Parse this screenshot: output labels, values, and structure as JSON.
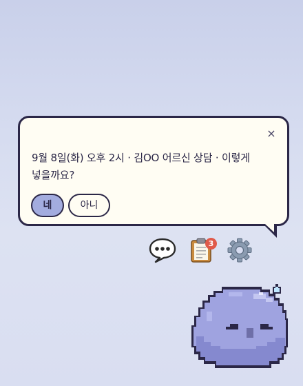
{
  "bubble": {
    "close_symbol": "×",
    "message_line1": "9월 8일(화) 오후 2시 · 김OO 어르신 상담 · 이렇게",
    "message_line2": "넣을까요?",
    "yes_label": "네",
    "no_label": "아니"
  },
  "actions": {
    "chat_icon": "speech-balloon-icon",
    "tasks_icon": "clipboard-icon",
    "tasks_badge": "3",
    "settings_icon": "gear-icon"
  },
  "mascot": {
    "name": "blob-mascot",
    "expression": "sleepy",
    "sweat_drop": true
  },
  "colors": {
    "accent": "#a3acdf",
    "outline": "#2b2747",
    "bubble_bg": "#fffdf3",
    "badge": "#e05a4a",
    "mascot_body": "#9fa3e0"
  }
}
